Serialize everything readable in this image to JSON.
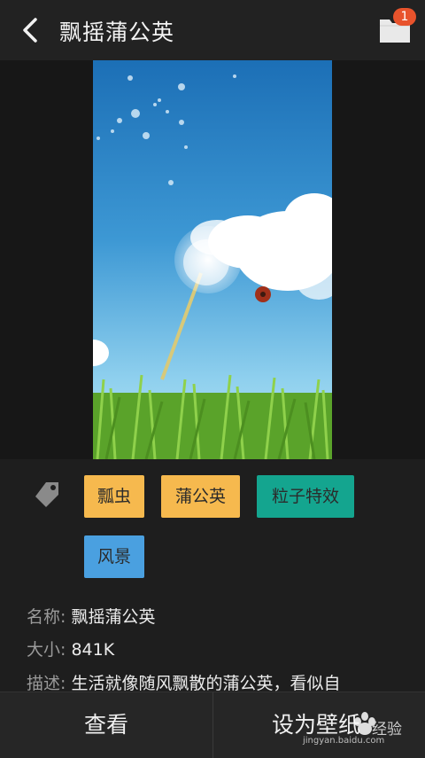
{
  "header": {
    "title": "飘摇蒲公英",
    "folder_badge": "1"
  },
  "tags": [
    {
      "label": "瓢虫",
      "color": "#f6b94e"
    },
    {
      "label": "蒲公英",
      "color": "#f6b94e"
    },
    {
      "label": "粒子特效",
      "color": "#14a58f"
    },
    {
      "label": "风景",
      "color": "#4aa0e0"
    }
  ],
  "info": {
    "name_key": "名称:",
    "name_value": "飘摇蒲公英",
    "size_key": "大小:",
    "size_value": "841K",
    "desc_key": "描述:",
    "desc_value": "生活就像随风飘散的蒲公英，看似自"
  },
  "bottom": {
    "view_label": "查看",
    "set_label": "设为壁纸"
  },
  "watermark": {
    "text": "经验",
    "url": "jingyan.baidu.com"
  },
  "colors": {
    "background": "#1e1e1e",
    "header": "#222222",
    "badge": "#e8532c"
  }
}
